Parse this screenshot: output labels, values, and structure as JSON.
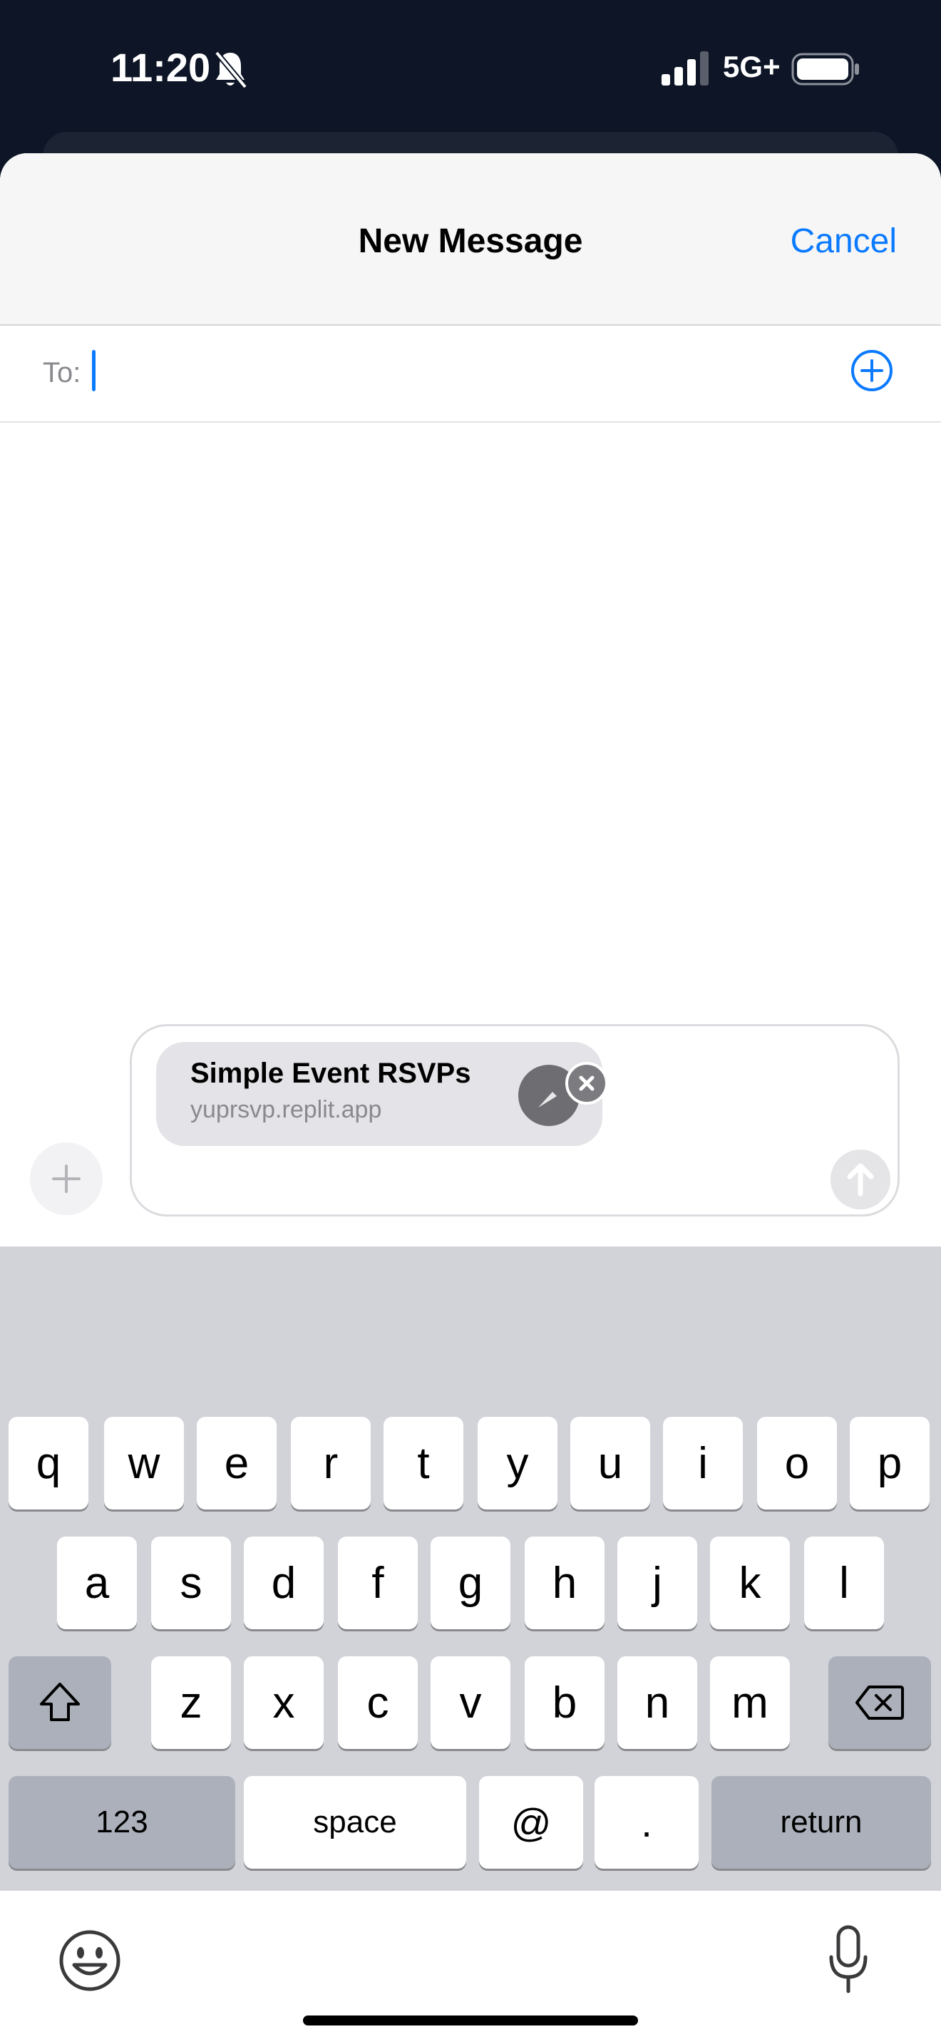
{
  "status_bar": {
    "time": "11:20",
    "network": "5G+",
    "icons": [
      "bell-slash-icon",
      "signal-icon",
      "battery-icon"
    ]
  },
  "header": {
    "title": "New Message",
    "cancel_label": "Cancel"
  },
  "recipient": {
    "label": "To:",
    "value": ""
  },
  "compose": {
    "link_preview": {
      "title": "Simple Event RSVPs",
      "url": "yuprsvp.replit.app"
    }
  },
  "keyboard": {
    "row1": [
      "q",
      "w",
      "e",
      "r",
      "t",
      "y",
      "u",
      "i",
      "o",
      "p"
    ],
    "row2": [
      "a",
      "s",
      "d",
      "f",
      "g",
      "h",
      "j",
      "k",
      "l"
    ],
    "row3": [
      "z",
      "x",
      "c",
      "v",
      "b",
      "n",
      "m"
    ],
    "numbers_label": "123",
    "space_label": "space",
    "at_label": "@",
    "period_label": ".",
    "return_label": "return"
  },
  "colors": {
    "accent": "#0a7aff",
    "status_bar_bg": "#0d1526",
    "keyboard_bg": "#d1d3d9"
  }
}
